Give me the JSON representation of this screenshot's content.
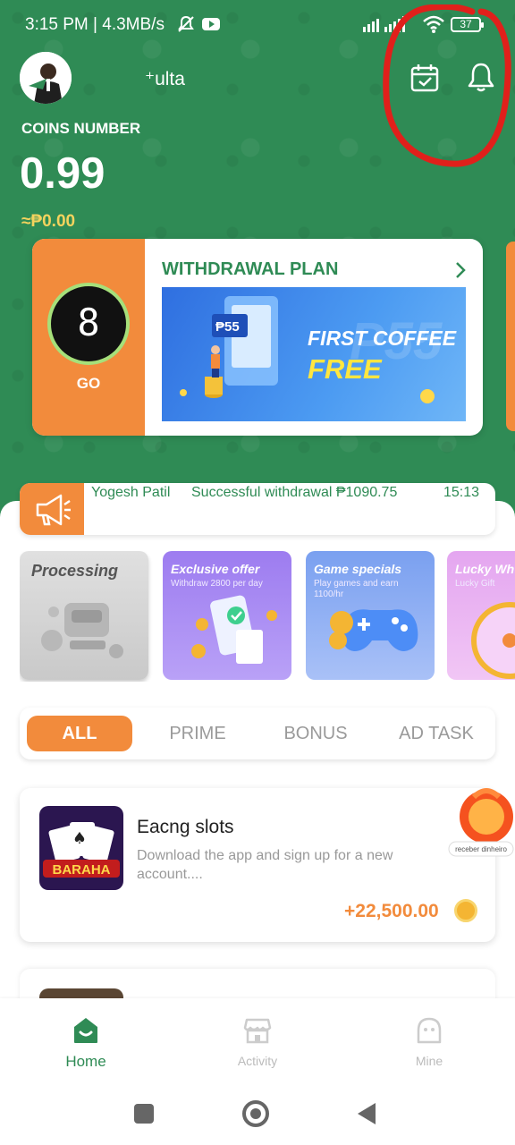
{
  "status_bar": {
    "time": "3:15 PM | 4.3MB/s",
    "battery": "37",
    "icons": [
      "mute-icon",
      "youtube-icon",
      "signal-icon",
      "wifi-icon",
      "battery-icon"
    ]
  },
  "header": {
    "username": "⁺ulta",
    "coins_label": "COINS NUMBER",
    "coins_value": "0.99",
    "coins_peso": "≈₱0.00",
    "icons": [
      "calendar-check-icon",
      "bell-icon"
    ]
  },
  "withdrawal_card": {
    "countdown": "8",
    "go_label": "GO",
    "title": "WITHDRAWAL PLAN",
    "banner_line1": "FIRST COFFEE",
    "banner_line2": "FREE",
    "banner_badge": "₱55"
  },
  "ticker": {
    "user": "Yogesh Patil",
    "message": "Successful withdrawal ₱1090.75",
    "time": "15:13"
  },
  "promos": [
    {
      "title": "Processing",
      "subtitle": ""
    },
    {
      "title": "Exclusive offer",
      "subtitle": "Withdraw 2800 per day"
    },
    {
      "title": "Game specials",
      "subtitle": "Play games and earn 1100/hr"
    },
    {
      "title": "Lucky Wh",
      "subtitle": "Lucky Gift"
    }
  ],
  "tabs": [
    "ALL",
    "PRIME",
    "BONUS",
    "AD TASK"
  ],
  "active_tab": "ALL",
  "tasks": [
    {
      "title": "Eacng slots",
      "description": "Download the app and sign up for a new account....",
      "reward": "+22,500.00",
      "icon_text": "BARAHA",
      "badge_text": "receber dinheiro"
    }
  ],
  "bottom_nav": {
    "items": [
      {
        "label": "Home",
        "icon": "home-icon"
      },
      {
        "label": "Activity",
        "icon": "store-icon"
      },
      {
        "label": "Mine",
        "icon": "profile-icon"
      }
    ],
    "active": "Home"
  },
  "colors": {
    "brand_green": "#2f8b55",
    "accent_orange": "#f28b3c",
    "gold": "#f4d35e",
    "annotation_red": "#e0201b"
  }
}
